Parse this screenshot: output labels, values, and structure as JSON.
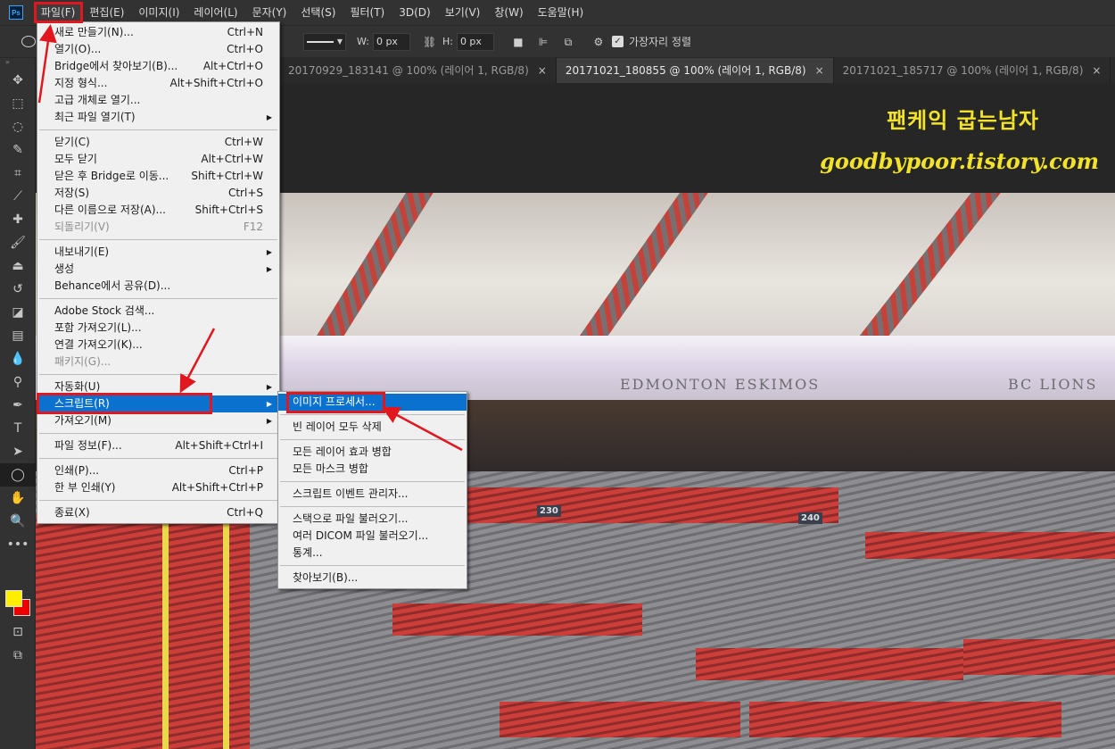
{
  "app": {
    "logo": "Ps"
  },
  "menubar": {
    "items": [
      "파일(F)",
      "편집(E)",
      "이미지(I)",
      "레이어(L)",
      "문자(Y)",
      "선택(S)",
      "필터(T)",
      "3D(D)",
      "보기(V)",
      "창(W)",
      "도움말(H)"
    ]
  },
  "options": {
    "w_label": "W:",
    "w_value": "0 px",
    "h_label": "H:",
    "h_value": "0 px",
    "align_edges": "가장자리 정렬"
  },
  "tabs": [
    {
      "label": "20170929_183141 @ 100% (레이어 1, RGB/8)",
      "close": "×"
    },
    {
      "label": "20171021_180855 @ 100% (레이어 1, RGB/8)",
      "close": "×"
    },
    {
      "label": "20171021_185717 @ 100% (레이어 1, RGB/8)",
      "close": "×"
    }
  ],
  "banner": {
    "title": "팬케익 굽는남자",
    "url": "goodbypoor.tistory.com"
  },
  "photo": {
    "screen_left": "EDMONTON ESKIMOS",
    "screen_right": "BC LIONS",
    "section_230": "230",
    "section_240": "240"
  },
  "file_menu": {
    "new": "새로 만들기(N)...",
    "new_sc": "Ctrl+N",
    "open": "열기(O)...",
    "open_sc": "Ctrl+O",
    "bridge": "Bridge에서 찾아보기(B)...",
    "bridge_sc": "Alt+Ctrl+O",
    "open_as": "지정 형식...",
    "open_as_sc": "Alt+Shift+Ctrl+O",
    "smart": "고급 개체로 열기...",
    "recent": "최근 파일 열기(T)",
    "close": "닫기(C)",
    "close_sc": "Ctrl+W",
    "close_all": "모두 닫기",
    "close_all_sc": "Alt+Ctrl+W",
    "close_bridge": "닫은 후 Bridge로 이동...",
    "close_bridge_sc": "Shift+Ctrl+W",
    "save": "저장(S)",
    "save_sc": "Ctrl+S",
    "save_as": "다른 이름으로 저장(A)...",
    "save_as_sc": "Shift+Ctrl+S",
    "revert": "되돌리기(V)",
    "revert_sc": "F12",
    "export": "내보내기(E)",
    "generate": "생성",
    "behance": "Behance에서 공유(D)...",
    "stock": "Adobe Stock 검색...",
    "place_embedded": "포함 가져오기(L)...",
    "place_linked": "연결 가져오기(K)...",
    "package": "패키지(G)...",
    "automate": "자동화(U)",
    "scripts": "스크립트(R)",
    "import": "가져오기(M)",
    "file_info": "파일 정보(F)...",
    "file_info_sc": "Alt+Shift+Ctrl+I",
    "print": "인쇄(P)...",
    "print_sc": "Ctrl+P",
    "print_one": "한 부 인쇄(Y)",
    "print_one_sc": "Alt+Shift+Ctrl+P",
    "exit": "종료(X)",
    "exit_sc": "Ctrl+Q"
  },
  "scripts_menu": {
    "image_processor": "이미지 프로세서...",
    "delete_empty": "빈 레이어 모두 삭제",
    "flatten_effects": "모든 레이어 효과 병합",
    "flatten_masks": "모든 마스크 병합",
    "event_manager": "스크립트 이벤트 관리자...",
    "load_stack": "스택으로 파일 불러오기...",
    "load_dicom": "여러 DICOM 파일 불러오기...",
    "statistics": "통계...",
    "browse": "찾아보기(B)..."
  },
  "colors": {
    "foreground": "#ffee00",
    "background": "#ee0000",
    "highlight": "#0a71cf",
    "annotation": "#e0171e",
    "banner_text": "#f2e32a"
  }
}
